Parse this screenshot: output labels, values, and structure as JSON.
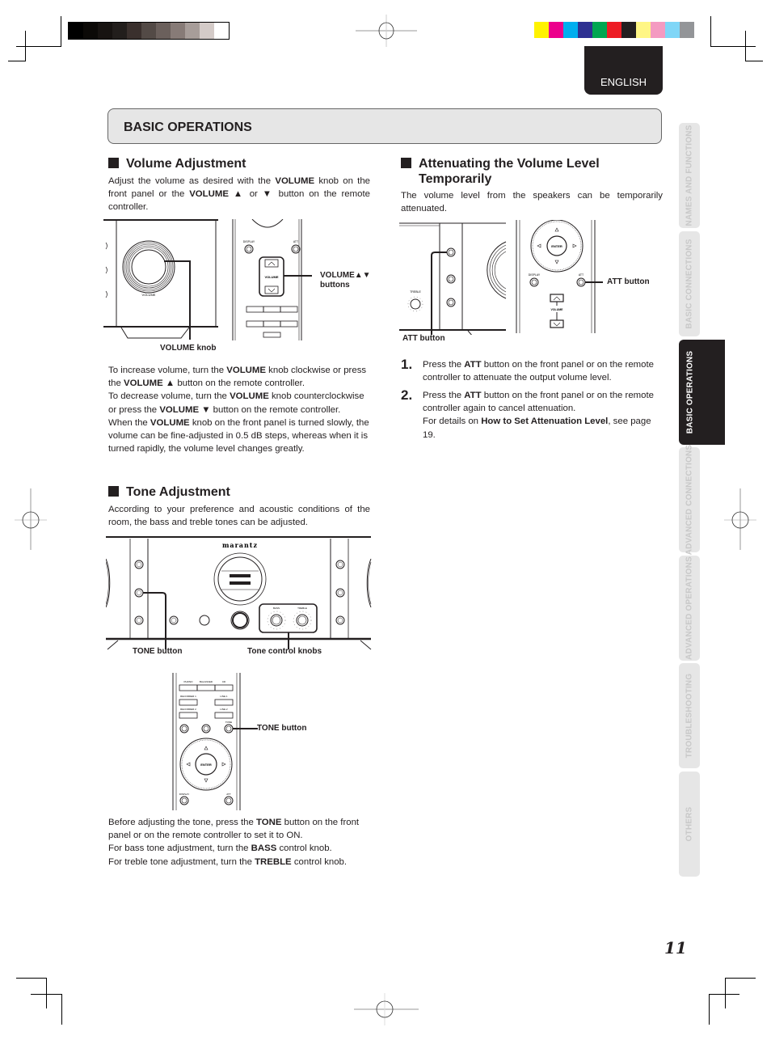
{
  "print_marks": {
    "grayscale_swatches": [
      "#000000",
      "#0b0907",
      "#171311",
      "#221e1c",
      "#3a302d",
      "#534a46",
      "#6b605c",
      "#877b77",
      "#a79d99",
      "#d4cbc8",
      "#ffffff"
    ],
    "color_swatches": [
      "#fff200",
      "#ec008c",
      "#00aeef",
      "#2e3192",
      "#00a651",
      "#ed1c24",
      "#231f20",
      "#fff685",
      "#f49ac1",
      "#7fd6f7",
      "#939598"
    ]
  },
  "language_tab": "ENGLISH",
  "section_title": "BASIC OPERATIONS",
  "volume": {
    "heading": "Volume Adjustment",
    "intro": [
      {
        "t": "Adjust the volume as desired with the "
      },
      {
        "b": "VOLUME"
      },
      {
        "t": " knob on the front panel or the "
      },
      {
        "b": "VOLUME ▲"
      },
      {
        "t": " or "
      },
      {
        "b": "▼"
      },
      {
        "t": " button on the remote controller."
      }
    ],
    "callouts": {
      "knob": "VOLUME knob",
      "buttons_line1": "VOLUME▲▼",
      "buttons_line2": "buttons"
    },
    "figure_labels": {
      "volume": "VOLUME",
      "display": "DISPLAY",
      "att": "ATT",
      "remote_volume": "VOLUME"
    },
    "body": [
      {
        "t": "To increase volume, turn the "
      },
      {
        "b": "VOLUME"
      },
      {
        "t": " knob clockwise or press the "
      },
      {
        "b": "VOLUME ▲"
      },
      {
        "t": " button on the remote controller."
      },
      {
        "br": true
      },
      {
        "t": "To decrease volume, turn the "
      },
      {
        "b": "VOLUME"
      },
      {
        "t": " knob counterclockwise or press the "
      },
      {
        "b": "VOLUME ▼"
      },
      {
        "t": " button on the remote controller."
      },
      {
        "br": true
      },
      {
        "t": "When the "
      },
      {
        "b": "VOLUME"
      },
      {
        "t": " knob on the front panel is turned slowly, the volume can be fine-adjusted in 0.5 dB steps, whereas when it is turned rapidly, the volume level changes greatly."
      }
    ]
  },
  "attenuate": {
    "heading_line1": "Attenuating the Volume Level",
    "heading_line2": "Temporarily",
    "intro": "The volume level from the speakers can be temporarily attenuated.",
    "callouts": {
      "front": "ATT button",
      "remote": "ATT button"
    },
    "figure_labels": {
      "enter": "ENTER",
      "display": "DISPLAY",
      "att": "ATT",
      "volume": "VOLUME"
    },
    "steps": [
      {
        "num": "1.",
        "text": [
          {
            "t": "Press the "
          },
          {
            "b": "ATT"
          },
          {
            "t": " button on the front panel or on the remote controller to attenuate the output volume level."
          }
        ]
      },
      {
        "num": "2.",
        "text": [
          {
            "t": "Press the "
          },
          {
            "b": "ATT"
          },
          {
            "t": " button on the front panel or on the remote controller again to cancel attenuation."
          },
          {
            "br": true
          },
          {
            "t": "For details on "
          },
          {
            "b": "How to Set Attenuation Level"
          },
          {
            "t": ", see page 19."
          }
        ]
      }
    ]
  },
  "tone": {
    "heading": "Tone Adjustment",
    "intro": "According to your preference and acoustic conditions of the room, the bass and treble tones can be adjusted.",
    "brand": "marantz",
    "callouts": {
      "tone_button": "TONE button",
      "tone_knobs": "Tone control knobs",
      "remote_tone_button": "TONE button"
    },
    "figure_labels": {
      "bass": "BASS",
      "treble": "TREBLE",
      "enter": "ENTER",
      "phono": "PHONO",
      "balanced": "BALANCED",
      "cd": "CD",
      "recorder1": "RECORDER 1",
      "line1": "LINE 1",
      "recorder2": "RECORDER 2",
      "line2": "LINE 2",
      "tone": "TONE",
      "display": "DISPLAY",
      "att": "ATT"
    },
    "body": [
      {
        "t": "Before adjusting the tone, press the "
      },
      {
        "b": "TONE"
      },
      {
        "t": " button on the front panel or on the remote controller to set it to ON."
      },
      {
        "br": true
      },
      {
        "t": "For bass tone adjustment, turn the "
      },
      {
        "b": "BASS"
      },
      {
        "t": " control knob."
      },
      {
        "br": true
      },
      {
        "t": "For treble tone adjustment, turn the "
      },
      {
        "b": "TREBLE"
      },
      {
        "t": " control knob."
      }
    ]
  },
  "side_tabs": [
    {
      "label": "NAMES AND FUNCTIONS",
      "active": false
    },
    {
      "label": "BASIC CONNECTIONS",
      "active": false
    },
    {
      "label": "BASIC OPERATIONS",
      "active": true
    },
    {
      "label": "ADVANCED CONNECTIONS",
      "active": false
    },
    {
      "label": "ADVANCED OPERATIONS",
      "active": false
    },
    {
      "label": "TROUBLESHOOTING",
      "active": false
    },
    {
      "label": "OTHERS",
      "active": false
    }
  ],
  "page_number": "11"
}
